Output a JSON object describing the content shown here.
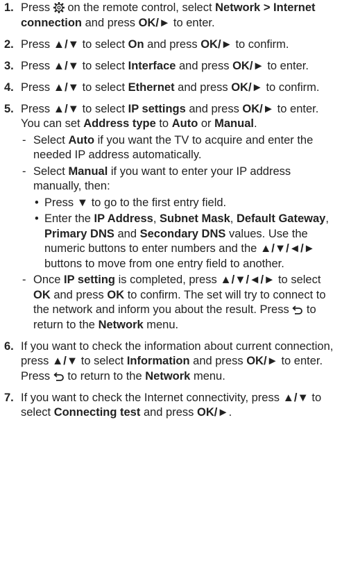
{
  "steps": [
    {
      "num": "1.",
      "parts": [
        {
          "t": "Press "
        },
        {
          "icon": "gear"
        },
        {
          "t": " on the remote control, select "
        },
        {
          "b": "Network > Internet connection"
        },
        {
          "t": " and press "
        },
        {
          "b": "OK/►"
        },
        {
          "t": " to enter."
        }
      ]
    },
    {
      "num": "2.",
      "parts": [
        {
          "t": "Press "
        },
        {
          "b": "▲/▼"
        },
        {
          "t": " to select "
        },
        {
          "b": "On"
        },
        {
          "t": " and press "
        },
        {
          "b": "OK/►"
        },
        {
          "t": " to confirm."
        }
      ]
    },
    {
      "num": "3.",
      "parts": [
        {
          "t": "Press "
        },
        {
          "b": "▲/▼"
        },
        {
          "t": " to select "
        },
        {
          "b": "Interface"
        },
        {
          "t": " and press "
        },
        {
          "b": "OK/►"
        },
        {
          "t": " to enter."
        }
      ]
    },
    {
      "num": "4.",
      "parts": [
        {
          "t": "Press "
        },
        {
          "b": "▲/▼"
        },
        {
          "t": " to select "
        },
        {
          "b": "Ethernet"
        },
        {
          "t": " and press "
        },
        {
          "b": "OK/►"
        },
        {
          "t": " to confirm."
        }
      ]
    },
    {
      "num": "5.",
      "parts": [
        {
          "t": "Press "
        },
        {
          "b": "▲/▼"
        },
        {
          "t": " to select "
        },
        {
          "b": "IP settings"
        },
        {
          "t": " and press "
        },
        {
          "b": "OK/►"
        },
        {
          "t": " to enter. You can set "
        },
        {
          "b": "Address type"
        },
        {
          "t": " to "
        },
        {
          "b": "Auto"
        },
        {
          "t": " or "
        },
        {
          "b": "Manual"
        },
        {
          "t": "."
        }
      ],
      "dashes": [
        {
          "parts": [
            {
              "t": "Select "
            },
            {
              "b": "Auto"
            },
            {
              "t": " if you want the TV to acquire and enter the needed IP address automatically."
            }
          ]
        },
        {
          "parts": [
            {
              "t": "Select "
            },
            {
              "b": "Manual"
            },
            {
              "t": " if you want to enter your IP address manually, then:"
            }
          ],
          "bullets": [
            {
              "parts": [
                {
                  "t": "Press "
                },
                {
                  "b": "▼"
                },
                {
                  "t": " to go to the first entry field."
                }
              ]
            },
            {
              "parts": [
                {
                  "t": "Enter the "
                },
                {
                  "b": "IP Address"
                },
                {
                  "t": ", "
                },
                {
                  "b": "Subnet Mask"
                },
                {
                  "t": ", "
                },
                {
                  "b": "Default Gateway"
                },
                {
                  "t": ", "
                },
                {
                  "b": "Primary DNS"
                },
                {
                  "t": " and "
                },
                {
                  "b": "Secondary DNS"
                },
                {
                  "t": " values. Use the numeric buttons to enter numbers and the "
                },
                {
                  "b": "▲/▼/◄/►"
                },
                {
                  "t": " buttons to move from one entry field to another."
                }
              ]
            }
          ]
        },
        {
          "parts": [
            {
              "t": "Once "
            },
            {
              "b": "IP setting"
            },
            {
              "t": " is completed, press "
            },
            {
              "b": "▲/▼/◄/►"
            },
            {
              "t": " to select "
            },
            {
              "b": "OK"
            },
            {
              "t": " and press "
            },
            {
              "b": "OK"
            },
            {
              "t": " to confirm. The set will try to connect to the network and inform you about the result. Press "
            },
            {
              "icon": "back"
            },
            {
              "t": " to return to the "
            },
            {
              "b": "Network"
            },
            {
              "t": " menu."
            }
          ]
        }
      ]
    },
    {
      "num": "6.",
      "parts": [
        {
          "t": "If you want to check the information about current connection, press "
        },
        {
          "b": "▲/▼"
        },
        {
          "t": " to select "
        },
        {
          "b": "Information"
        },
        {
          "t": " and press "
        },
        {
          "b": "OK/►"
        },
        {
          "t": " to enter. Press "
        },
        {
          "icon": "back"
        },
        {
          "t": " to return to the "
        },
        {
          "b": "Network"
        },
        {
          "t": " menu."
        }
      ]
    },
    {
      "num": "7.",
      "parts": [
        {
          "t": "If you want to check the Internet connectivity, press "
        },
        {
          "b": "▲/▼"
        },
        {
          "t": " to select "
        },
        {
          "b": "Connecting test"
        },
        {
          "t": " and press "
        },
        {
          "b": "OK/►"
        },
        {
          "t": "."
        }
      ]
    }
  ],
  "dash_mark": "-",
  "bullet_mark": "•",
  "icons": {
    "gear": "gear-icon",
    "back": "return-arrow-icon"
  }
}
